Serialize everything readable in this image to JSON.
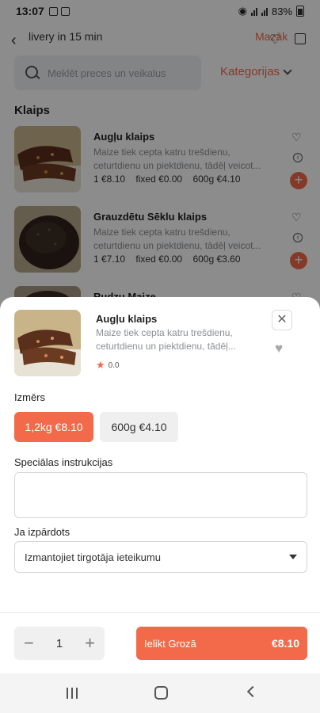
{
  "status": {
    "time": "13:07",
    "battery": "83%"
  },
  "header": {
    "delivery_text": "livery in 15 min",
    "more_link": "Mazāk"
  },
  "search": {
    "placeholder": "Meklēt preces un veikalus"
  },
  "categories_label": "Kategorijas",
  "section_title": "Klaips",
  "products": [
    {
      "name": "Augļu klaips",
      "desc_1": "Maize tiek cepta katru trešdienu,",
      "desc_2": "ceturtdienu un piektdienu, tādēļ veicot...",
      "price_1": "1 €8.10",
      "price_2": "fixed €0.00",
      "price_3": "600g €4.10"
    },
    {
      "name": "Grauzdētu Sēklu klaips",
      "desc_1": "Maize tiek cepta katru trešdienu,",
      "desc_2": "ceturtdienu un piektdienu, tādēļ veicot...",
      "price_1": "1 €7.10",
      "price_2": "fixed €0.00",
      "price_3": "600g €3.60"
    },
    {
      "name": "Rudzu Maize"
    }
  ],
  "sheet": {
    "name": "Augļu klaips",
    "desc_1": "Maize tiek cepta katru trešdienu,",
    "desc_2": "ceturtdienu un piektdienu, tādēļ...",
    "rating": "0.0",
    "size_label": "Izmērs",
    "sizes": [
      "1,2kg €8.10",
      "600g €4.10"
    ],
    "instructions_label": "Speciālas instrukcijas",
    "sold_out_label": "Ja izpārdots",
    "sold_out_value": "Izmantojiet tirgotāja ieteikumu",
    "quantity": "1",
    "cart_label": "Ielikt Grozā",
    "cart_price": "€8.10"
  },
  "colors": {
    "accent": "#f26a4a"
  }
}
